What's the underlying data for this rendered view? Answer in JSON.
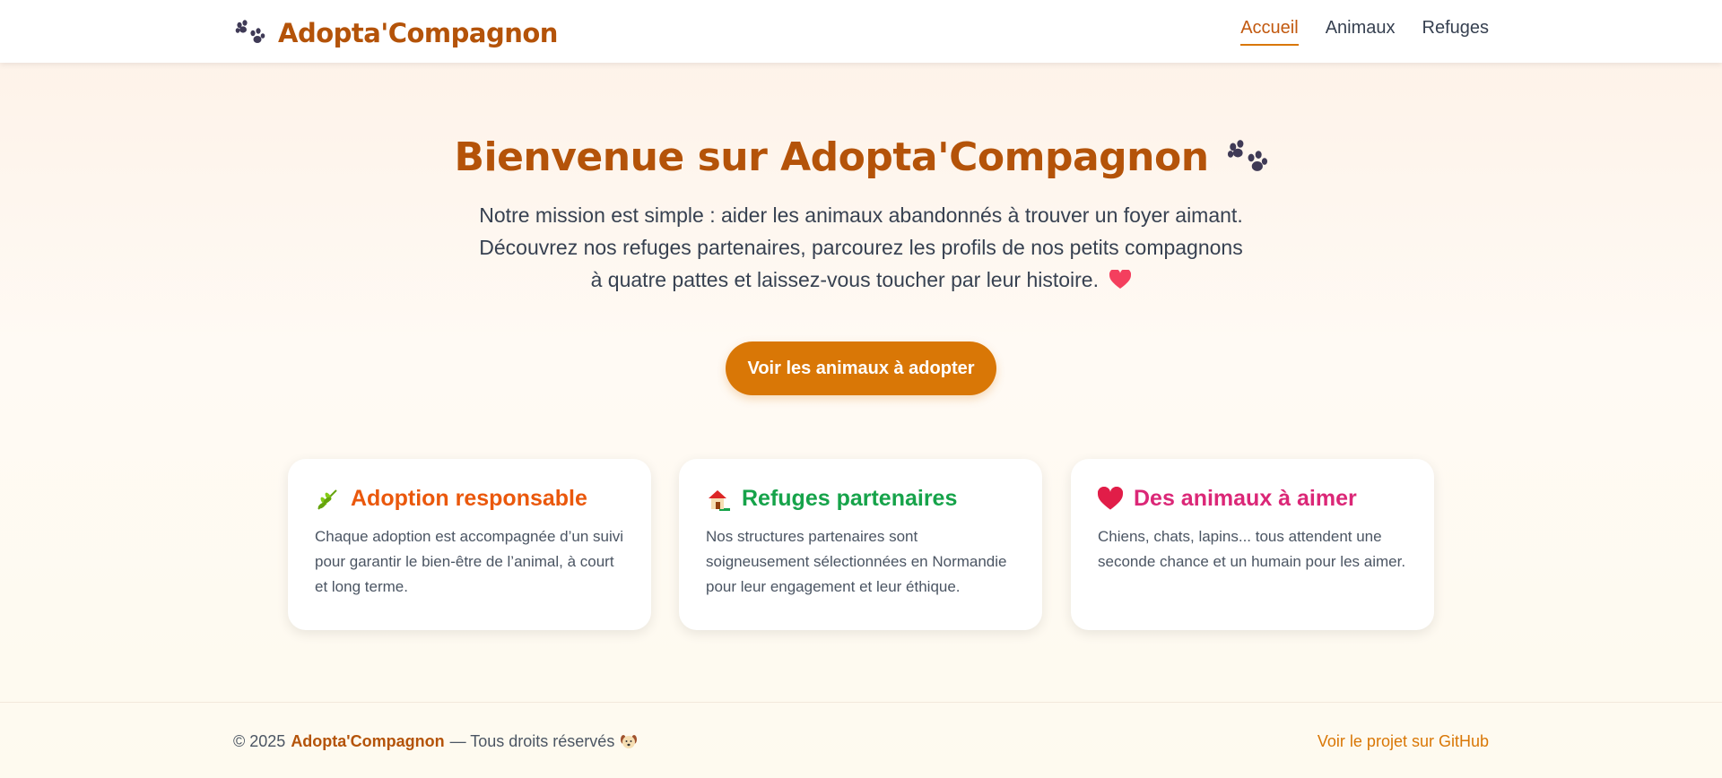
{
  "header": {
    "brand_icon": "paw-prints-icon",
    "brand_name": "Adopta'Compagnon",
    "nav": [
      {
        "label": "Accueil",
        "active": true
      },
      {
        "label": "Animaux",
        "active": false
      },
      {
        "label": "Refuges",
        "active": false
      }
    ]
  },
  "hero": {
    "title": "Bienvenue sur Adopta'Compagnon",
    "title_icon": "paw-prints-icon",
    "text": "Notre mission est simple : aider les animaux abandonnés à trouver un foyer aimant. Découvrez nos refuges partenaires, parcourez les profils de nos petits compagnons à quatre pattes et laissez-vous toucher par leur histoire.",
    "text_icon": "heart-icon",
    "cta_label": "Voir les animaux à adopter"
  },
  "features": [
    {
      "icon": "herb-icon",
      "title": "Adoption responsable",
      "title_color": "#ea580c",
      "body": "Chaque adoption est accompagnée d’un suivi pour garantir le bien-être de l’animal, à court et long terme."
    },
    {
      "icon": "house-icon",
      "title": "Refuges partenaires",
      "title_color": "#16a34a",
      "body": "Nos structures partenaires sont soigneusement sélectionnées en Normandie pour leur engagement et leur éthique."
    },
    {
      "icon": "heart-icon",
      "title": "Des animaux à aimer",
      "title_color": "#db2777",
      "body": "Chiens, chats, lapins... tous attendent une seconde chance et un humain pour les aimer."
    }
  ],
  "footer": {
    "copyright_prefix": "© 2025",
    "brand": "Adopta'Compagnon",
    "copyright_suffix": "— Tous droits réservés",
    "footer_icon": "dog-face-icon",
    "github_link": "Voir le projet sur GitHub"
  },
  "colors": {
    "brand": "#b45309",
    "accent": "#d97706",
    "text": "#374151"
  }
}
